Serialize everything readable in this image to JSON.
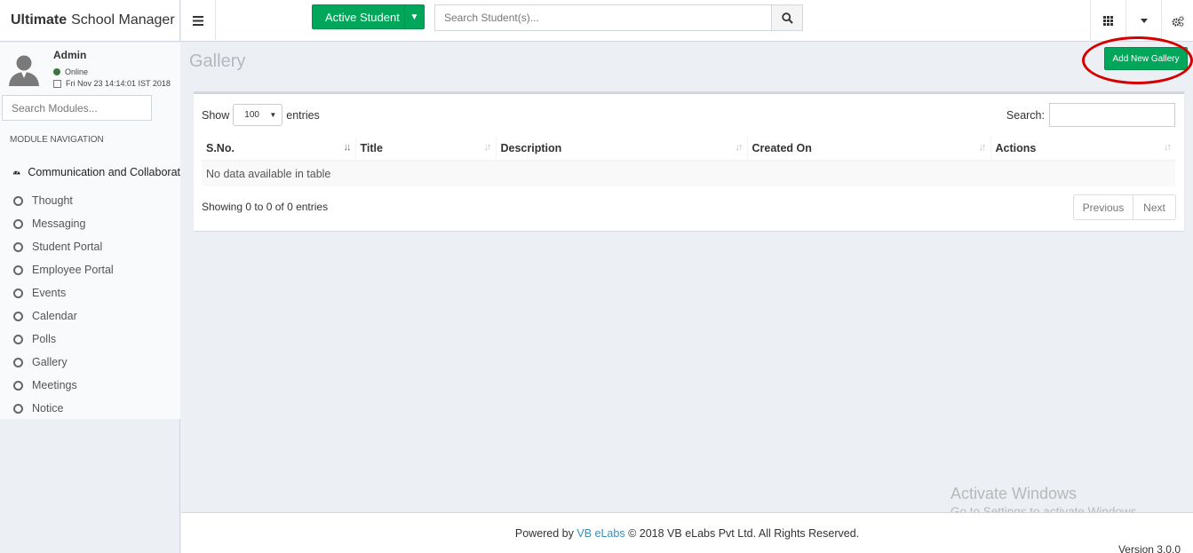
{
  "app": {
    "title_bold": "Ultimate",
    "title_rest": "School Manager"
  },
  "header": {
    "active_student_label": "Active Student",
    "student_search_placeholder": "Search Student(s)...",
    "icons": [
      "menu-icon",
      "search-icon",
      "grid-icon",
      "caret-down-icon",
      "settings-cogs-icon"
    ]
  },
  "user": {
    "name": "Admin",
    "status": "Online",
    "datetime": "Fri Nov 23 14:14:01 IST 2018"
  },
  "sidebar": {
    "module_search_placeholder": "Search Modules...",
    "nav_heading": "MODULE NAVIGATION",
    "category_label": "Communication and Collaborat",
    "items": [
      {
        "label": "Thought"
      },
      {
        "label": "Messaging"
      },
      {
        "label": "Student Portal"
      },
      {
        "label": "Employee Portal"
      },
      {
        "label": "Events"
      },
      {
        "label": "Calendar"
      },
      {
        "label": "Polls"
      },
      {
        "label": "Gallery"
      },
      {
        "label": "Meetings"
      },
      {
        "label": "Notice"
      }
    ]
  },
  "page": {
    "title": "Gallery",
    "add_button_label": "Add New Gallery"
  },
  "table": {
    "show_label": "Show",
    "page_length": "100",
    "entries_label": "entries",
    "search_label": "Search:",
    "columns": [
      "S.No.",
      "Title",
      "Description",
      "Created On",
      "Actions"
    ],
    "empty_message": "No data available in table",
    "info": "Showing 0 to 0 of 0 entries",
    "prev_label": "Previous",
    "next_label": "Next"
  },
  "footer": {
    "powered_by": "Powered by",
    "company_link": "VB eLabs",
    "copyright": "© 2018 VB eLabs Pvt Ltd. All Rights Reserved.",
    "version": "Version 3.0.0"
  },
  "watermark": {
    "line1": "Activate Windows",
    "line2": "Go to Settings to activate Windows."
  },
  "colors": {
    "accent_green": "#00a65a",
    "link_blue": "#3c8dbc",
    "highlight_red": "#d40000",
    "content_bg": "#ecf0f5"
  }
}
